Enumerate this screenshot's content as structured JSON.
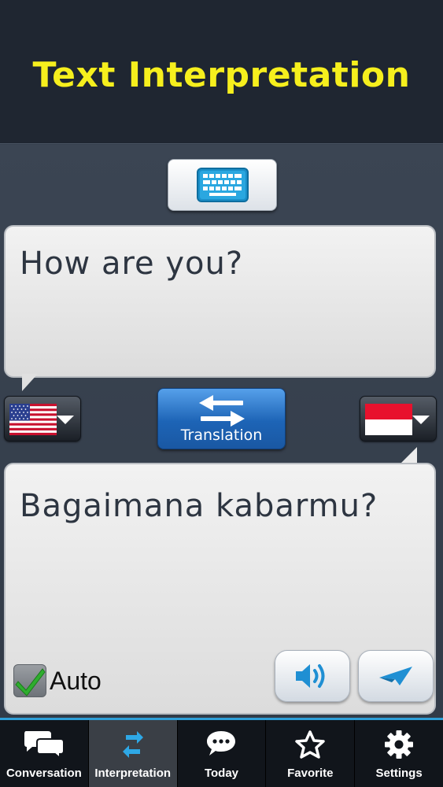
{
  "header": {
    "title": "Text Interpretation"
  },
  "keyboard": {
    "icon": "keyboard-icon"
  },
  "source": {
    "text": "How are you?",
    "language_flag": "us-flag-icon"
  },
  "target": {
    "text": "Bagaimana kabarmu?",
    "language_flag": "indonesia-flag-icon"
  },
  "translate": {
    "label": "Translation",
    "icon": "swap-arrows-icon"
  },
  "auto": {
    "label": "Auto",
    "checked": true
  },
  "actions": {
    "speak_icon": "speaker-icon",
    "send_icon": "send-plane-icon"
  },
  "tabs": [
    {
      "label": "Conversation",
      "icon": "chat-bubbles-icon",
      "active": false
    },
    {
      "label": "Interpretation",
      "icon": "swap-arrows-icon",
      "active": true
    },
    {
      "label": "Today",
      "icon": "speech-bubble-icon",
      "active": false
    },
    {
      "label": "Favorite",
      "icon": "star-icon",
      "active": false
    },
    {
      "label": "Settings",
      "icon": "gear-icon",
      "active": false
    }
  ],
  "colors": {
    "title": "#f6ef1d",
    "accent": "#2e9fd8",
    "translate_button": "#1d64b6",
    "text": "#2d3541"
  }
}
